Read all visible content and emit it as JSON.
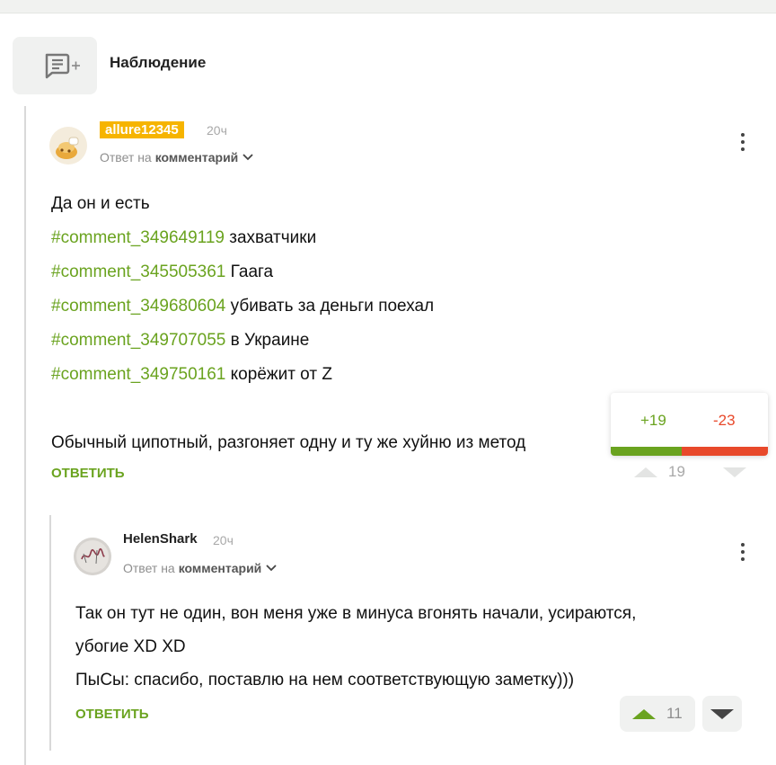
{
  "header": {
    "note_button_icon": "comment-add-icon",
    "note_label": "Наблюдение"
  },
  "comment1": {
    "username": "allure12345",
    "username_badge_color": "#f6b400",
    "time": "20ч",
    "reply_prefix": "Ответ на",
    "reply_target": "комментарий",
    "lines": [
      {
        "hash": "",
        "text": "Да он и есть"
      },
      {
        "hash": "#comment_349649119",
        "text": " захватчики"
      },
      {
        "hash": "#comment_345505361",
        "text": " Гаага"
      },
      {
        "hash": "#comment_349680604",
        "text": " убивать за деньги поехал"
      },
      {
        "hash": "#comment_349707055",
        "text": " в Украине"
      },
      {
        "hash": "#comment_349750161",
        "text": " корёжит от Z"
      },
      {
        "hash": "",
        "text": ""
      },
      {
        "hash": "",
        "text": "Обычный ципотный, разгоняет одну и ту же хуйню из метод"
      }
    ],
    "answer_label": "ответить",
    "rating": {
      "plus": "+19",
      "minus": "-23",
      "total": "19"
    }
  },
  "comment2": {
    "username": "HelenShark",
    "time": "20ч",
    "reply_prefix": "Ответ на",
    "reply_target": "комментарий",
    "lines": [
      "Так он тут не один, вон меня уже в минуса вгонять начали, усираются,",
      "убогие XD XD",
      "ПыСы: спасибо, поставлю на нем соответствующую заметку)))"
    ],
    "answer_label": "ответить",
    "rating_total": "11"
  },
  "colors": {
    "accent_green": "#6aa31f",
    "minus_red": "#e8492b"
  }
}
